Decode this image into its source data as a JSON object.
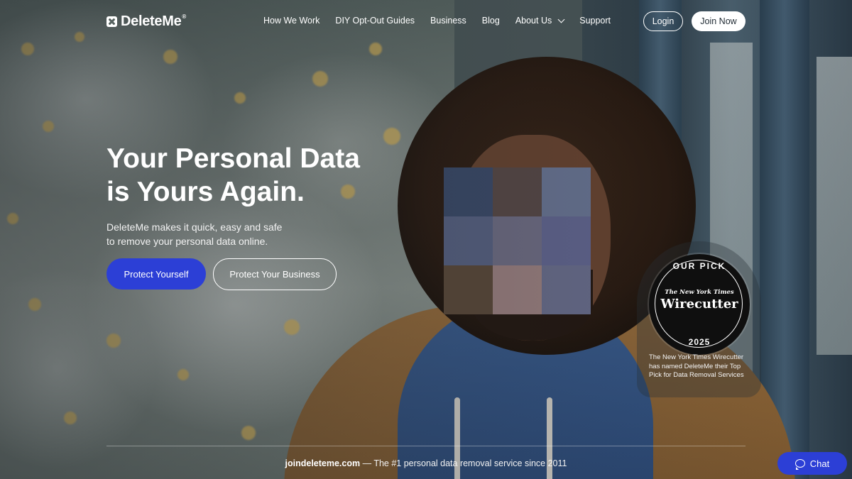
{
  "brand": {
    "name": "DeleteMe",
    "trademark": "®"
  },
  "nav": {
    "items": [
      {
        "label": "How We Work"
      },
      {
        "label": "DIY Opt-Out Guides"
      },
      {
        "label": "Business"
      },
      {
        "label": "Blog"
      },
      {
        "label": "About Us",
        "has_dropdown": true
      },
      {
        "label": "Support"
      }
    ],
    "login_label": "Login",
    "join_label": "Join Now"
  },
  "hero": {
    "title_line1": "Your Personal Data",
    "title_line2": "is Yours Again.",
    "subtitle_line1": "DeleteMe makes it quick, easy and safe",
    "subtitle_line2": "to remove your personal data online.",
    "primary_cta": "Protect Yourself",
    "secondary_cta": "Protect Your Business"
  },
  "badge": {
    "top_text": "OUR PICK",
    "publisher": "The New York Times",
    "brand": "Wirecutter",
    "year": "2025",
    "caption": "The New York Times Wirecutter has named DeleteMe their Top Pick for Data Removal Services"
  },
  "footer": {
    "domain": "joindeleteme.com",
    "tagline": " — The #1 personal data removal service since 2011"
  },
  "chat": {
    "label": "Chat",
    "icon": "chat-bubble-icon"
  },
  "colors": {
    "primary_button": "#2c3fd6",
    "text": "#ffffff"
  }
}
